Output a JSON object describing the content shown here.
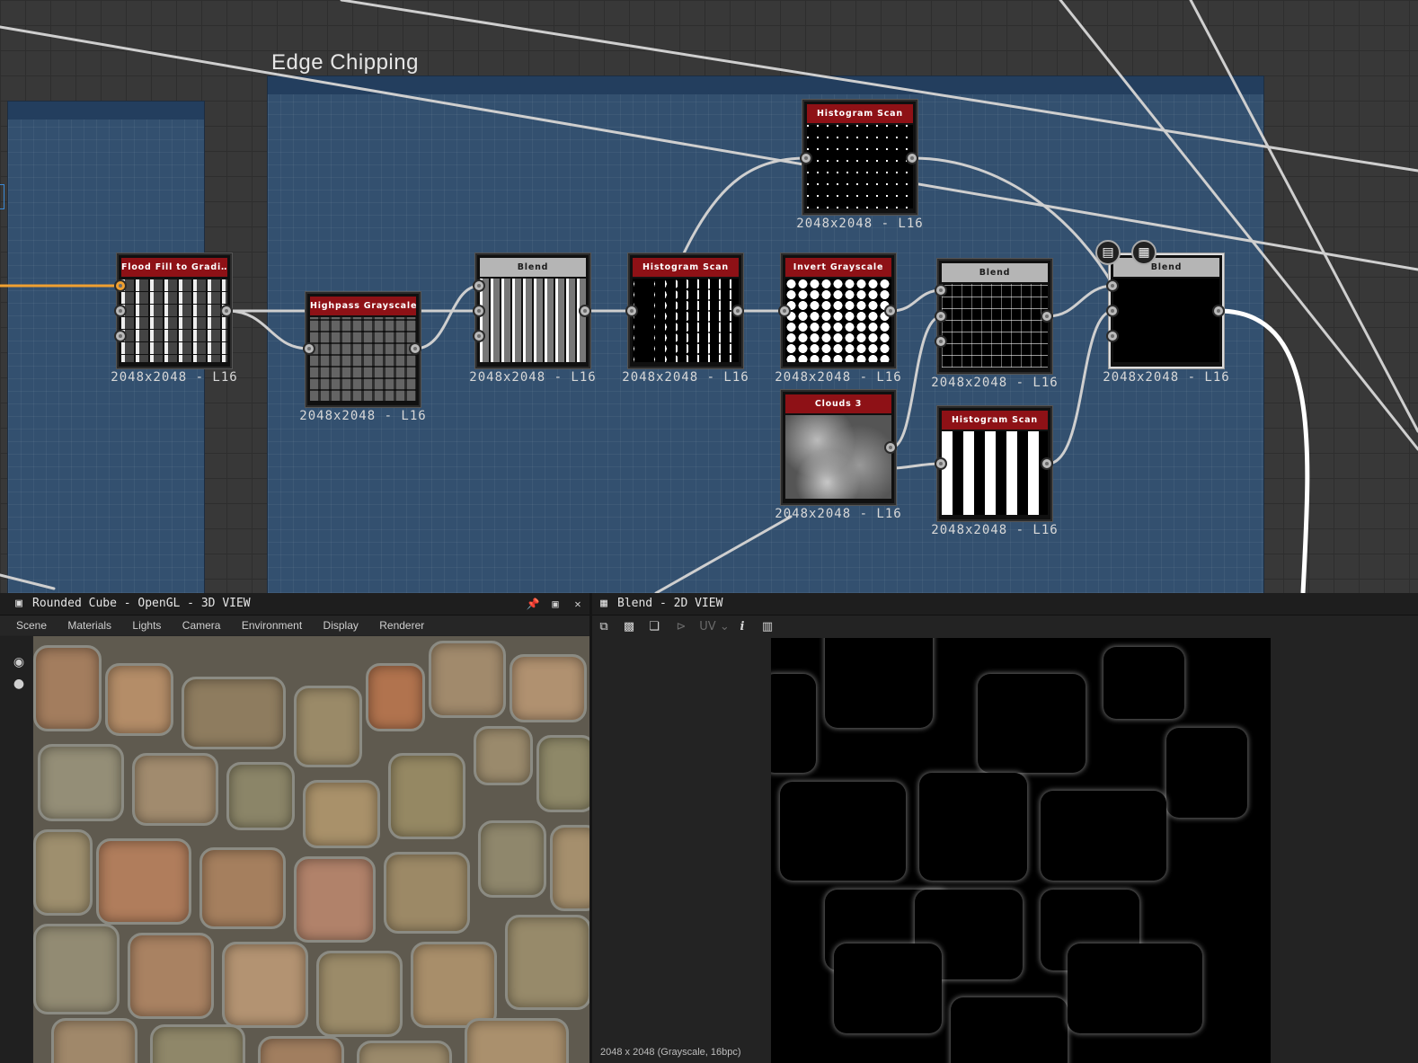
{
  "graph": {
    "frame_title": "Edge Chipping",
    "nodes": [
      {
        "id": "flood",
        "title": "Flood Fill to Gradi…",
        "size": "2048x2048 - L16"
      },
      {
        "id": "highpass",
        "title": "Highpass Grayscale",
        "size": "2048x2048 - L16"
      },
      {
        "id": "blend1",
        "title": "Blend",
        "size": "2048x2048 - L16"
      },
      {
        "id": "hist1",
        "title": "Histogram Scan",
        "size": "2048x2048 - L16"
      },
      {
        "id": "hist_top",
        "title": "Histogram Scan",
        "size": "2048x2048 - L16"
      },
      {
        "id": "invert",
        "title": "Invert Grayscale",
        "size": "2048x2048 - L16"
      },
      {
        "id": "blend2",
        "title": "Blend",
        "size": "2048x2048 - L16"
      },
      {
        "id": "blend3",
        "title": "Blend",
        "size": "2048x2048 - L16"
      },
      {
        "id": "clouds",
        "title": "Clouds 3",
        "size": "2048x2048 - L16"
      },
      {
        "id": "hist3",
        "title": "Histogram Scan",
        "size": "2048x2048 - L16"
      }
    ],
    "badges": {
      "doc": "doc-icon",
      "view": "checker-icon"
    }
  },
  "panel3d": {
    "title": "Rounded Cube - OpenGL - 3D VIEW",
    "menu": [
      "Scene",
      "Materials",
      "Lights",
      "Camera",
      "Environment",
      "Display",
      "Renderer"
    ],
    "pin": "📌",
    "restore": "▣",
    "close": "✕"
  },
  "panel2d": {
    "title": "Blend - 2D VIEW",
    "uv_label": "UV",
    "info_label": "i",
    "status": "2048 x 2048 (Grayscale, 16bpc)"
  },
  "colors": {
    "frame": "#33506f",
    "node_header": "#8e1116",
    "selection": "#dcdcdc",
    "wire": "#cfcfcf",
    "input_wire": "#f0a030"
  }
}
